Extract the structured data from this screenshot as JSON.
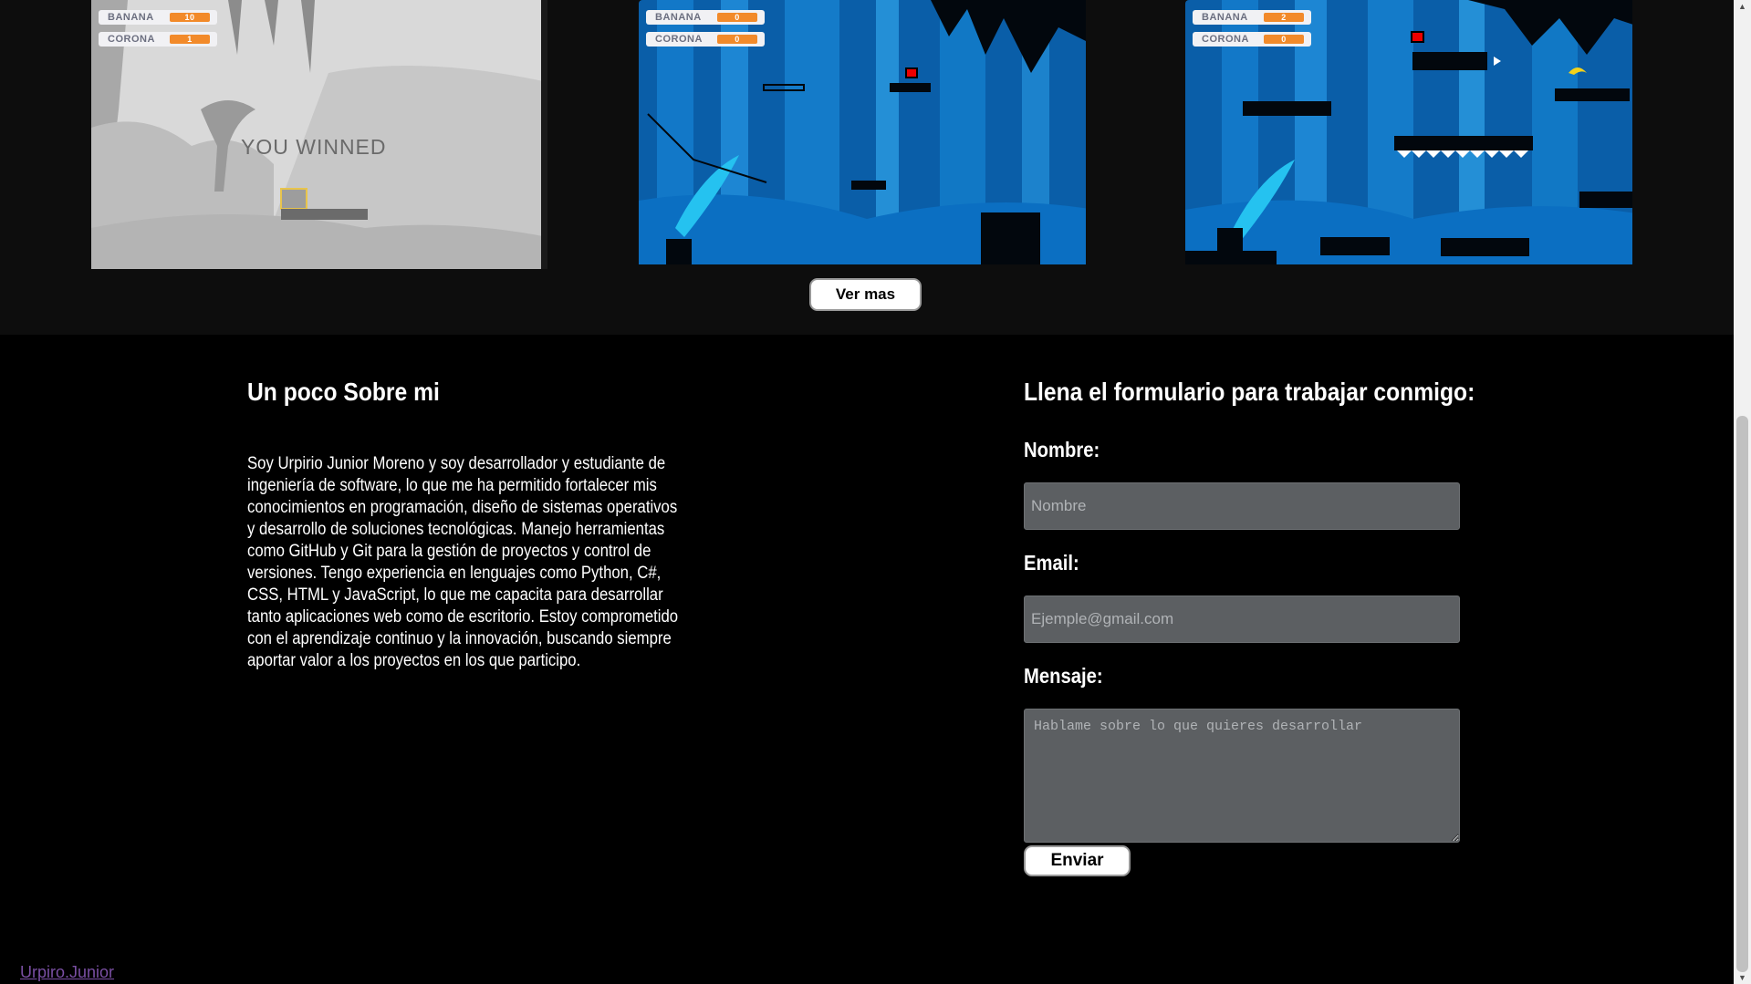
{
  "projects": [
    {
      "hud": [
        {
          "label": "BANANA",
          "value": "10"
        },
        {
          "label": "CORONA",
          "value": "1"
        }
      ],
      "message": "YOU WINNED"
    },
    {
      "hud": [
        {
          "label": "BANANA",
          "value": "0"
        },
        {
          "label": "CORONA",
          "value": "0"
        }
      ]
    },
    {
      "hud": [
        {
          "label": "BANANA",
          "value": "2"
        },
        {
          "label": "CORONA",
          "value": "0"
        }
      ]
    }
  ],
  "gallery": {
    "ver_mas_label": "Ver mas"
  },
  "about": {
    "title": "Un poco Sobre mi",
    "text": "Soy Urpirio Junior Moreno y soy desarrollador y estudiante de ingeniería de software, lo que me ha permitido fortalecer mis conocimientos en programación, diseño de sistemas operativos y desarrollo de soluciones tecnológicas. Manejo herramientas como GitHub y Git para la gestión de proyectos y control de versiones. Tengo experiencia en lenguajes como Python, C#, CSS, HTML y JavaScript, lo que me capacita para desarrollar tanto aplicaciones web como de escritorio. Estoy comprometido con el aprendizaje continuo y la innovación, buscando siempre aportar valor a los proyectos en los que participo."
  },
  "form": {
    "title": "Llena el formulario para trabajar conmigo:",
    "name_label": "Nombre:",
    "name_placeholder": "Nombre",
    "email_label": "Email:",
    "email_placeholder": "Ejemple@gmail.com",
    "message_label": "Mensaje:",
    "message_placeholder": "Hablame sobre lo que quieres desarrollar",
    "submit_label": "Enviar"
  },
  "footer": {
    "link_text": "Urpiro.Junior"
  },
  "colors": {
    "hud_value": "#f28a2a",
    "game_blue": "#1a8fe0",
    "link": "#7a4fa3"
  }
}
